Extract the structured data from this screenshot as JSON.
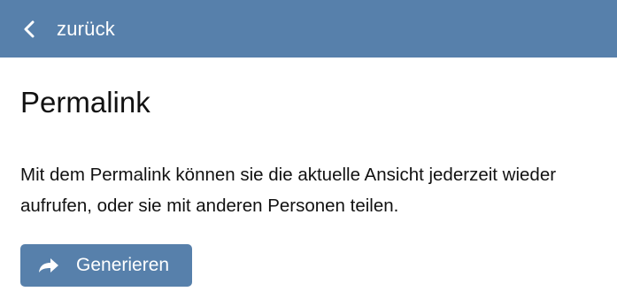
{
  "header": {
    "back_label": "zurück",
    "back_icon": "chevron-left-icon"
  },
  "main": {
    "title": "Permalink",
    "description": "Mit dem Permalink können sie die aktuelle Ansicht jederzeit wieder aufrufen, oder sie mit anderen Personen teilen.",
    "generate_button": {
      "label": "Generieren",
      "icon": "share-arrow-icon"
    }
  },
  "colors": {
    "accent": "#5780ab",
    "text": "#111111",
    "background": "#ffffff"
  }
}
